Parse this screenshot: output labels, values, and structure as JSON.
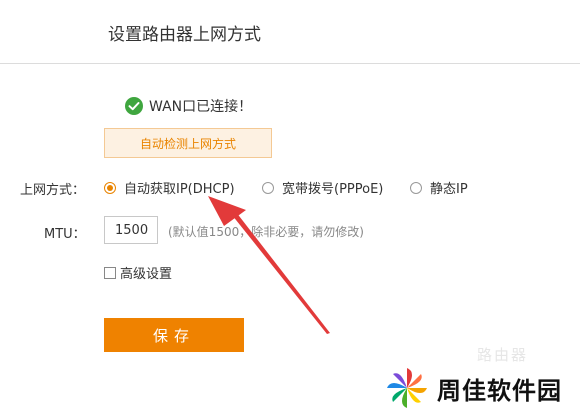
{
  "header": {
    "title": "设置路由器上网方式"
  },
  "status": {
    "text": "WAN口已连接！",
    "color": "#3fa63f"
  },
  "detect_button": {
    "label": "自动检测上网方式"
  },
  "connection_mode": {
    "label": "上网方式：",
    "options": [
      {
        "label": "自动获取IP(DHCP)",
        "selected": true
      },
      {
        "label": "宽带拨号(PPPoE)",
        "selected": false
      },
      {
        "label": "静态IP",
        "selected": false
      }
    ]
  },
  "mtu": {
    "label": "MTU：",
    "value": "1500",
    "hint": "(默认值1500，除非必要，请勿修改)"
  },
  "advanced": {
    "label": "高级设置",
    "checked": false
  },
  "save_button": {
    "label": "保存"
  },
  "colors": {
    "accent": "#ef8200",
    "arrow": "#e23a3a"
  },
  "watermark": {
    "text": "周佳软件园",
    "ghost_text": "路由器"
  }
}
